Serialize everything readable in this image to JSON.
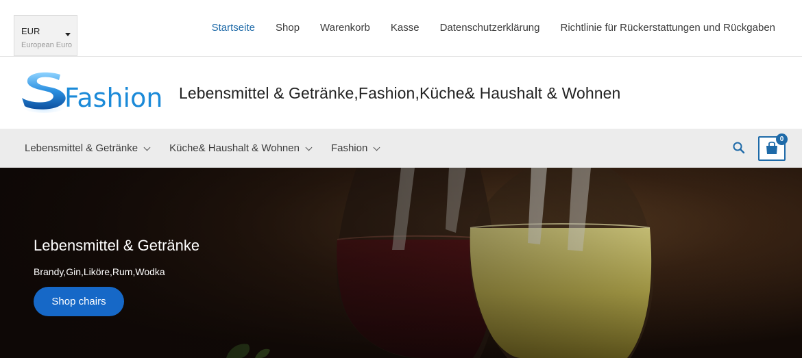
{
  "currency": {
    "code": "EUR",
    "name": "European Euro"
  },
  "top_nav": [
    {
      "label": "Startseite",
      "active": true
    },
    {
      "label": "Shop",
      "active": false
    },
    {
      "label": "Warenkorb",
      "active": false
    },
    {
      "label": "Kasse",
      "active": false
    },
    {
      "label": "Datenschutzerklärung",
      "active": false
    },
    {
      "label": "Richtlinie für Rückerstattungen und Rückgaben",
      "active": false
    }
  ],
  "header": {
    "logo_text": "Fashion",
    "title": "Lebensmittel & Getränke,Fashion,Küche& Haushalt & Wohnen"
  },
  "main_menu": [
    {
      "label": "Lebensmittel & Getränke"
    },
    {
      "label": "Küche& Haushalt & Wohnen"
    },
    {
      "label": "Fashion"
    }
  ],
  "cart": {
    "count": "0"
  },
  "hero": {
    "title": "Lebensmittel & Getränke",
    "subtitle": "Brandy,Gin,Liköre,Rum,Wodka",
    "button_label": "Shop chairs"
  },
  "icons": {
    "search": "search-icon",
    "cart": "shopping-bag-icon",
    "dropdown": "chevron-down-icon"
  },
  "colors": {
    "accent": "#1e6aa8",
    "button": "#1668c7",
    "navbar_bg": "#ececec"
  }
}
